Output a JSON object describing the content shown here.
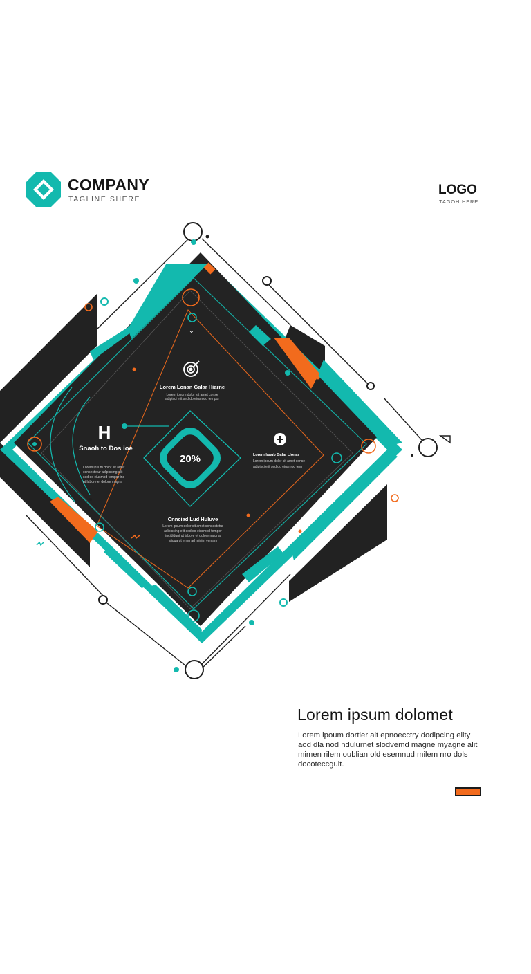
{
  "header": {
    "company_name": "COMPANY",
    "tagline": "TAGLINE SHERE",
    "logo_text": "LOGO",
    "logo_tagline": "TAGOH HERE"
  },
  "graphic": {
    "top_block": {
      "icon": "target-icon",
      "title": "Lorem Lonan Galar Hiarne",
      "body_lines": [
        "Lorem ipsum dolor sit amet conse",
        "adipisci elit sed do eiusmod tempor"
      ]
    },
    "left_block": {
      "letter": "H",
      "title": "Snaoh to Dos ioe",
      "body_lines": [
        "Lorem ipsum dolor sit amet",
        "consectetur adipiscing elit",
        "sed do eiusmod tempor inc",
        "ut labore et dolore magna"
      ]
    },
    "right_block": {
      "icon": "plus-icon",
      "title": "Lorem laaub Galar Llonar",
      "body_lines": [
        "Lorem ipsum dolor sit amet conse",
        "adipisci elit sed do eiusmod tem"
      ]
    },
    "bottom_block": {
      "title": "Cnnciad Lud Huluve",
      "body_lines": [
        "Lorem ipsum dolor sit amet consectetur",
        "adipiscing elit sed do eiusmod tempor",
        "incididunt ut labore et dolore magna",
        "aliqua ut enim ad minim veniam"
      ]
    },
    "center_value": "20%"
  },
  "content": {
    "heading": "Lorem ipsum dolomet",
    "body": "Lorem lpoum dortler ait epnoecctry dodipcing elity aod dla nod ndulurnet slodvemd magne myagne alit mimen rilem oublian old esemnud milem nro dols docoteccgult."
  },
  "colors": {
    "teal": "#13b9ae",
    "orange": "#f26b1d",
    "dark": "#232323",
    "text": "#151515"
  }
}
